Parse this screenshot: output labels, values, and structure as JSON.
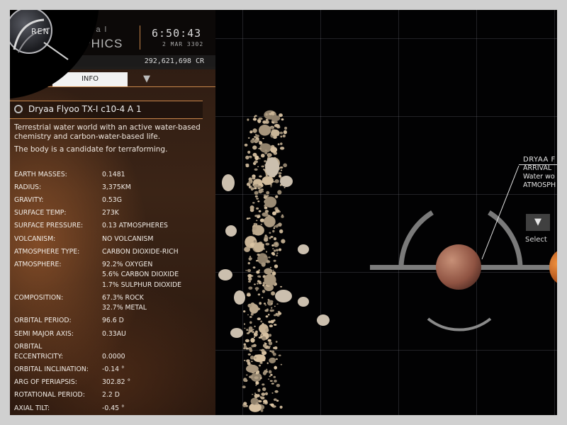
{
  "header": {
    "logo_text": "REN",
    "title_partial": "sal",
    "subtitle_partial": "APHICS",
    "time": "6:50:43",
    "date": "2 MAR 3302",
    "credits": "292,621,698 CR"
  },
  "tabs": {
    "info_label": "INFO"
  },
  "body": {
    "name": "Dryaa Flyoo TX-I c10-4 A 1",
    "description": [
      "Terrestrial water world with an active water-based chemistry and carbon-water-based life.",
      "The body is a candidate for terraforming."
    ],
    "properties": [
      {
        "key": "EARTH MASSES:",
        "value": "0.1481"
      },
      {
        "key": "RADIUS:",
        "value": "3,375KM"
      },
      {
        "key": "GRAVITY:",
        "value": "0.53G"
      },
      {
        "key": "SURFACE TEMP:",
        "value": "273K"
      },
      {
        "key": "SURFACE PRESSURE:",
        "value": "0.13 ATMOSPHERES"
      },
      {
        "key": "VOLCANISM:",
        "value": "NO VOLCANISM"
      },
      {
        "key": "ATMOSPHERE TYPE:",
        "value": "CARBON DIOXIDE-RICH"
      },
      {
        "key": "ATMOSPHERE:",
        "value": "92.2% OXYGEN\n5.6% CARBON DIOXIDE\n1.7% SULPHUR DIOXIDE"
      },
      {
        "key": "COMPOSITION:",
        "value": "67.3% ROCK\n32.7% METAL"
      },
      {
        "key": "ORBITAL PERIOD:",
        "value": "96.6 D"
      },
      {
        "key": "SEMI MAJOR AXIS:",
        "value": "0.33AU"
      },
      {
        "key": "ORBITAL ECCENTRICITY:",
        "value": "0.0000"
      },
      {
        "key": "ORBITAL INCLINATION:",
        "value": "-0.14 °"
      },
      {
        "key": "ARG OF PERIAPSIS:",
        "value": "302.82 °"
      },
      {
        "key": "ROTATIONAL PERIOD:",
        "value": "2.2 D"
      },
      {
        "key": "AXIAL TILT:",
        "value": "-0.45 °"
      }
    ]
  },
  "map": {
    "callout_name": "DRYAA F",
    "callout_line1": "ARRIVAL",
    "callout_line2": "Water wo",
    "callout_line3": "ATMOSPH",
    "select_label": "Select"
  },
  "colors": {
    "accent": "#c8864a",
    "panel_bg": "#2b1a12"
  },
  "icons": [
    "ring-icon",
    "pin-icon",
    "select-pin-icon",
    "logo-icon"
  ]
}
